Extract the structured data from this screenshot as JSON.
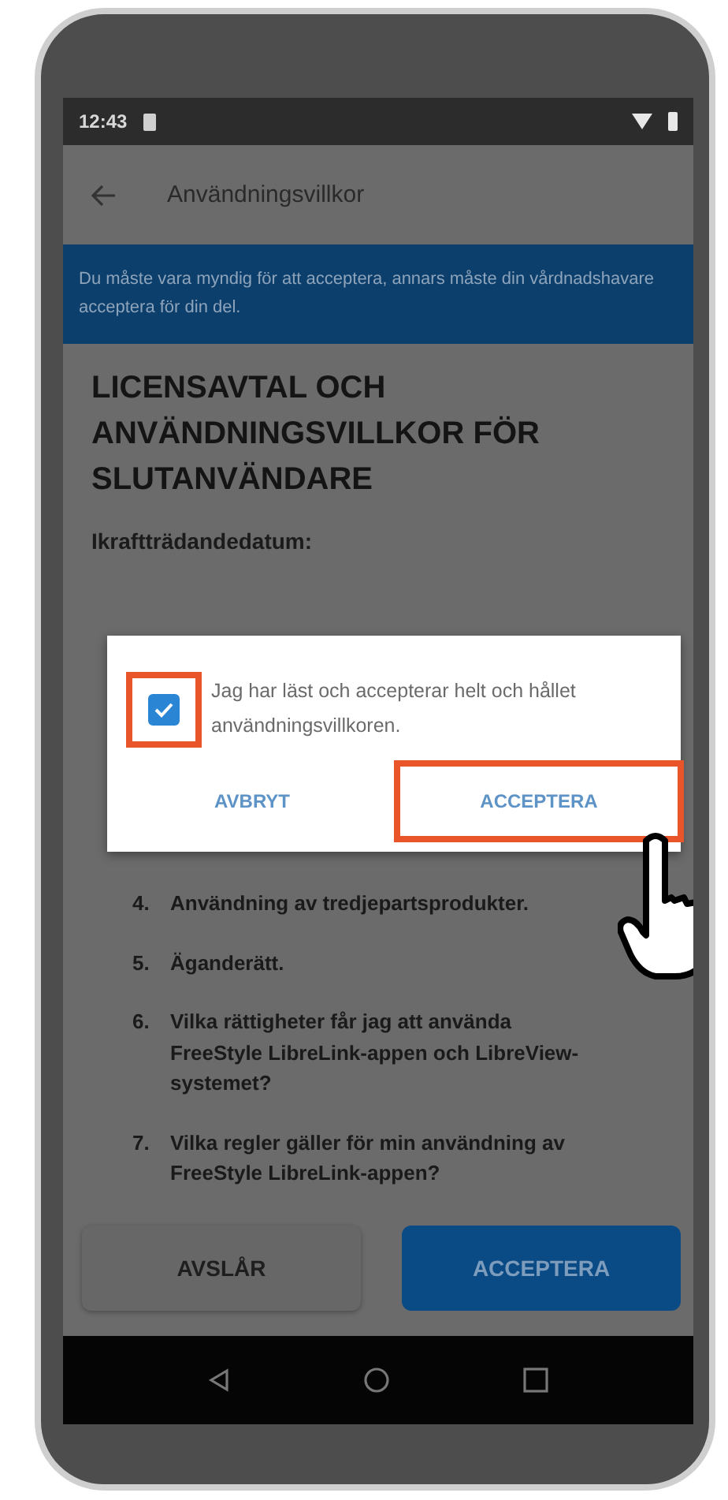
{
  "status_bar": {
    "time": "12:43"
  },
  "app_bar": {
    "title": "Användningsvillkor"
  },
  "banner": "Du måste vara myndig för att acceptera, annars måste din vårdnadshavare acceptera för din del.",
  "heading": "LICENSAVTAL OCH ANVÄNDNINGSVILLKOR FÖR SLUTANVÄNDARE",
  "effective_date_label": "Ikraftträdandedatum:",
  "sections": [
    {
      "number": "4.",
      "title": "Användning av tredjepartsprodukter."
    },
    {
      "number": "5.",
      "title": "Äganderätt."
    },
    {
      "number": "6.",
      "title": "Vilka rättigheter får jag att använda FreeStyle LibreLink-appen och LibreView-systemet?"
    },
    {
      "number": "7.",
      "title": "Vilka regler gäller för min användning av FreeStyle LibreLink-appen?"
    }
  ],
  "footer_buttons": [
    {
      "label": "AVSLÅR",
      "kind": "secondary"
    },
    {
      "label": "ACCEPTERA",
      "kind": "primary"
    }
  ],
  "dialog": {
    "checkbox": {
      "label": "Jag har läst och accepterar helt och hållet användningsvillkoren.",
      "checked": true,
      "highlighted": true
    },
    "buttons": [
      {
        "label": "AVBRYT",
        "highlighted": false
      },
      {
        "label": "ACCEPTERA",
        "highlighted": true
      }
    ]
  }
}
